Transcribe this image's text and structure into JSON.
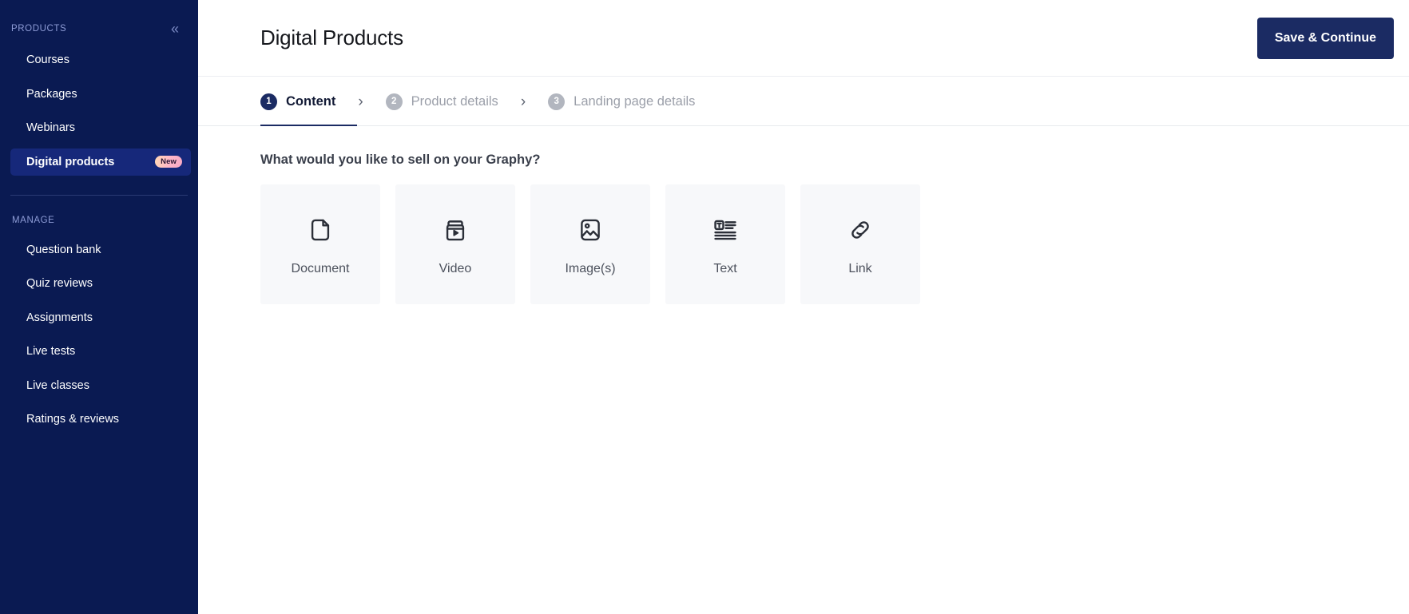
{
  "sidebar": {
    "products_label": "PRODUCTS",
    "collapse_icon": "double-chevron-left-icon",
    "manage_label": "MANAGE",
    "product_items": [
      {
        "label": "Courses",
        "badge": "",
        "active": false
      },
      {
        "label": "Packages",
        "badge": "",
        "active": false
      },
      {
        "label": "Webinars",
        "badge": "",
        "active": false
      },
      {
        "label": "Digital products",
        "badge": "New",
        "active": true
      }
    ],
    "manage_items": [
      {
        "label": "Question bank"
      },
      {
        "label": "Quiz reviews"
      },
      {
        "label": "Assignments"
      },
      {
        "label": "Live tests"
      },
      {
        "label": "Live classes"
      },
      {
        "label": "Ratings & reviews"
      }
    ]
  },
  "header": {
    "title": "Digital Products",
    "save_button": "Save & Continue"
  },
  "stepper": {
    "separator": "›",
    "steps": [
      {
        "number": "1",
        "label": "Content",
        "active": true
      },
      {
        "number": "2",
        "label": "Product details",
        "active": false
      },
      {
        "number": "3",
        "label": "Landing page details",
        "active": false
      }
    ]
  },
  "content": {
    "question": "What would you like to sell on your Graphy?",
    "cards": [
      {
        "label": "Document",
        "icon": "document-icon"
      },
      {
        "label": "Video",
        "icon": "video-icon"
      },
      {
        "label": "Image(s)",
        "icon": "image-icon"
      },
      {
        "label": "Text",
        "icon": "text-icon"
      },
      {
        "label": "Link",
        "icon": "link-icon"
      }
    ]
  },
  "colors": {
    "sidebar_bg": "#0a1a52",
    "sidebar_active": "#16287a",
    "accent_navy": "#1b2b63",
    "card_bg": "#f7f8fa",
    "badge_pink": "#ffb6c8"
  }
}
